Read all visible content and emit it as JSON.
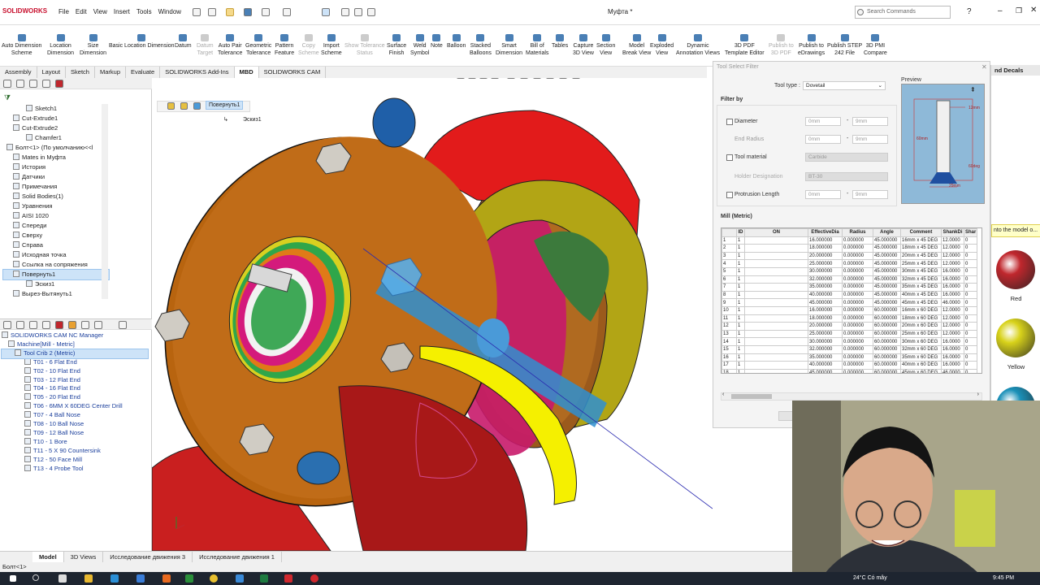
{
  "app": {
    "logo": "SOLIDWORKS",
    "menu": [
      "File",
      "Edit",
      "View",
      "Insert",
      "Tools",
      "Window"
    ],
    "document_title": "Муфта *",
    "search_placeholder": "Search Commands"
  },
  "commands": [
    {
      "label": "Auto Dimension\nScheme",
      "enabled": true
    },
    {
      "label": "Location\nDimension",
      "enabled": true
    },
    {
      "label": "Size\nDimension",
      "enabled": true
    },
    {
      "label": "Basic Location Dimension",
      "enabled": true
    },
    {
      "label": "Datum",
      "enabled": true
    },
    {
      "label": "Datum\nTarget",
      "enabled": false
    },
    {
      "label": "Auto Pair\nTolerance",
      "enabled": true
    },
    {
      "label": "Geometric\nTolerance",
      "enabled": true
    },
    {
      "label": "Pattern\nFeature",
      "enabled": true
    },
    {
      "label": "Copy\nScheme",
      "enabled": false
    },
    {
      "label": "Import\nScheme",
      "enabled": true
    },
    {
      "label": "Show Tolerance\nStatus",
      "enabled": false
    },
    {
      "label": "Surface\nFinish",
      "enabled": true
    },
    {
      "label": "Weld\nSymbol",
      "enabled": true
    },
    {
      "label": "Note",
      "enabled": true
    },
    {
      "label": "Balloon",
      "enabled": true
    },
    {
      "label": "Stacked\nBalloons",
      "enabled": true
    },
    {
      "label": "Smart\nDimension",
      "enabled": true
    },
    {
      "label": "Bill of\nMaterials",
      "enabled": true
    },
    {
      "label": "Tables",
      "enabled": true
    },
    {
      "label": "Capture\n3D View",
      "enabled": true
    },
    {
      "label": "Section\nView",
      "enabled": true
    },
    {
      "label": "Model\nBreak View",
      "enabled": true
    },
    {
      "label": "Exploded\nView",
      "enabled": true
    },
    {
      "label": "Dynamic\nAnnotation Views",
      "enabled": true
    },
    {
      "label": "3D PDF\nTemplate Editor",
      "enabled": true
    },
    {
      "label": "Publish to\n3D PDF",
      "enabled": false
    },
    {
      "label": "Publish to\neDrawings",
      "enabled": true
    },
    {
      "label": "Publish STEP\n242 File",
      "enabled": true
    },
    {
      "label": "3D PMI\nCompare",
      "enabled": true
    }
  ],
  "tabs": [
    "Assembly",
    "Layout",
    "Sketch",
    "Markup",
    "Evaluate",
    "SOLIDWORKS Add-Ins",
    "MBD",
    "SOLIDWORKS CAM"
  ],
  "active_tab": "MBD",
  "feature_tree": [
    "Sketch1",
    "Cut-Extrude1",
    "Cut-Extrude2",
    "Chamfer1",
    "Болт<1> (По умолчанию<<l",
    "Mates in Муфта",
    "История",
    "Датчики",
    "Примечания",
    "Solid Bodies(1)",
    "Уравнения",
    "AISI 1020",
    "Спереди",
    "Сверху",
    "Справа",
    "Исходная точка",
    "Ссылка на сопряжения",
    "Повернуть1",
    "Эскиз1",
    "Вырез-Вытянуть1"
  ],
  "cam_tree": {
    "title": "SOLIDWORKS CAM NC Manager",
    "machine": "Machine[Mill - Metric]",
    "crib": "Tool Crib 2 (Metric)",
    "tools": [
      "T01 - 6 Flat End",
      "T02 - 10 Flat End",
      "T03 - 12 Flat End",
      "T04 - 16 Flat End",
      "T05 - 20 Flat End",
      "T06 - 6MM X 60DEG Center Drill",
      "T07 - 4 Ball Nose",
      "T08 - 10 Ball Nose",
      "T09 - 12 Ball Nose",
      "T10 - 1 Bore",
      "T11 - 5 X 90 Countersink",
      "T12 - 50 Face Mill",
      "T13 - 4 Probe Tool"
    ]
  },
  "viewport_tree": {
    "item": "Повернуть1",
    "child": "Эскиз1"
  },
  "dialog": {
    "title": "Tool Select Filter",
    "tool_type_label": "Tool type :",
    "tool_type_value": "Dovetail",
    "filter_by": "Filter by",
    "preview_label": "Preview",
    "filters": [
      {
        "label": "Diameter",
        "from": "0mm",
        "to": "9mm"
      },
      {
        "label": "End Radius",
        "from": "0mm",
        "to": "9mm"
      },
      {
        "label": "Tool material",
        "value": "Carbide"
      },
      {
        "label": "Holder Designation",
        "value": "BT-30"
      },
      {
        "label": "Protrusion Length",
        "from": "0mm",
        "to": "9mm"
      }
    ],
    "preview_dims": [
      "12mm",
      "60mm",
      "60deg",
      "29mm"
    ],
    "table_title": "Mill (Metric)",
    "columns": [
      "",
      "ID",
      "ON",
      "EffectiveDia",
      "Radius",
      "Angle",
      "Comment",
      "ShankDi",
      "Shar"
    ],
    "rows": [
      [
        "1",
        "1",
        "",
        "16.000000",
        "0.000000",
        "45.000000",
        "16mm x 45 DEG",
        "12.0000",
        "0"
      ],
      [
        "2",
        "1",
        "",
        "18.000000",
        "0.000000",
        "45.000000",
        "18mm x 45 DEG",
        "12.0000",
        "0"
      ],
      [
        "3",
        "1",
        "",
        "20.000000",
        "0.000000",
        "45.000000",
        "20mm x 45 DEG",
        "12.0000",
        "0"
      ],
      [
        "4",
        "1",
        "",
        "25.000000",
        "0.000000",
        "45.000000",
        "25mm x 45 DEG",
        "12.0000",
        "0"
      ],
      [
        "5",
        "1",
        "",
        "30.000000",
        "0.000000",
        "45.000000",
        "30mm x 45 DEG",
        "16.0000",
        "0"
      ],
      [
        "6",
        "1",
        "",
        "32.000000",
        "0.000000",
        "45.000000",
        "32mm x 45 DEG",
        "16.0000",
        "0"
      ],
      [
        "7",
        "1",
        "",
        "35.000000",
        "0.000000",
        "45.000000",
        "35mm x 45 DEG",
        "16.0000",
        "0"
      ],
      [
        "8",
        "1",
        "",
        "40.000000",
        "0.000000",
        "45.000000",
        "40mm x 45 DEG",
        "16.0000",
        "0"
      ],
      [
        "9",
        "1",
        "",
        "45.000000",
        "0.000000",
        "45.000000",
        "45mm x 45 DEG",
        "46.0000",
        "0"
      ],
      [
        "10",
        "1",
        "",
        "16.000000",
        "0.000000",
        "60.000000",
        "16mm x 60 DEG",
        "12.0000",
        "0"
      ],
      [
        "11",
        "1",
        "",
        "18.000000",
        "0.000000",
        "60.000000",
        "18mm x 60 DEG",
        "12.0000",
        "0"
      ],
      [
        "12",
        "1",
        "",
        "20.000000",
        "0.000000",
        "60.000000",
        "20mm x 60 DEG",
        "12.0000",
        "0"
      ],
      [
        "13",
        "1",
        "",
        "25.000000",
        "0.000000",
        "60.000000",
        "25mm x 60 DEG",
        "12.0000",
        "0"
      ],
      [
        "14",
        "1",
        "",
        "30.000000",
        "0.000000",
        "60.000000",
        "30mm x 60 DEG",
        "16.0000",
        "0"
      ],
      [
        "15",
        "1",
        "",
        "32.000000",
        "0.000000",
        "60.000000",
        "32mm x 60 DEG",
        "16.0000",
        "0"
      ],
      [
        "16",
        "1",
        "",
        "35.000000",
        "0.000000",
        "60.000000",
        "35mm x 60 DEG",
        "16.0000",
        "0"
      ],
      [
        "17",
        "1",
        "",
        "40.000000",
        "0.000000",
        "60.000000",
        "40mm x 60 DEG",
        "16.0000",
        "0"
      ],
      [
        "18",
        "1",
        "",
        "45.000000",
        "0.000000",
        "60.000000",
        "45mm x 60 DEG",
        "46.0000",
        "0"
      ]
    ]
  },
  "decals": {
    "title": "nd Decals",
    "tip": "nto the model o...",
    "items": [
      {
        "name": "Red",
        "color": "#c0272d"
      },
      {
        "name": "Yellow",
        "color": "#d8d21a"
      },
      {
        "name": "",
        "color": "#1a90b8"
      }
    ]
  },
  "bottom_tabs": [
    "Model",
    "3D Views",
    "Исследование движения 3",
    "Исследование движения 1"
  ],
  "status_text": "Болт<1>",
  "tray": {
    "weather": "24°C Có mây",
    "time": "9:45 PM"
  },
  "colors": {
    "brand": "#c8102e",
    "tree_link": "#1b3f9c",
    "selection": "#cde3f8"
  }
}
